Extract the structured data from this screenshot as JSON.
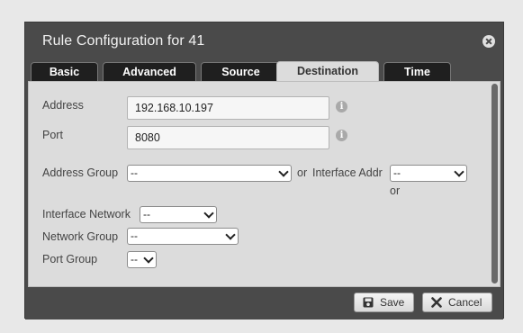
{
  "dialog": {
    "title": "Rule Configuration for 41",
    "close_icon": "close-circle-icon"
  },
  "tabs": [
    {
      "label": "Basic",
      "active": false
    },
    {
      "label": "Advanced",
      "active": false
    },
    {
      "label": "Source",
      "active": false
    },
    {
      "label": "Destination",
      "active": true
    },
    {
      "label": "Time",
      "active": false
    }
  ],
  "form": {
    "address_label": "Address",
    "address_value": "192.168.10.197",
    "port_label": "Port",
    "port_value": "8080",
    "info_icon": "info-icon",
    "address_group_label": "Address Group",
    "address_group_value": "--",
    "or_label_1": "or",
    "interface_addr_label": "Interface Addr",
    "interface_addr_value": "--",
    "or_label_2": "or",
    "interface_network_label": "Interface Network",
    "interface_network_value": "--",
    "network_group_label": "Network Group",
    "network_group_value": "--",
    "port_group_label": "Port Group",
    "port_group_value": "--"
  },
  "footer": {
    "save_label": "Save",
    "save_icon": "floppy-disk-icon",
    "cancel_label": "Cancel",
    "cancel_icon": "x-icon"
  }
}
